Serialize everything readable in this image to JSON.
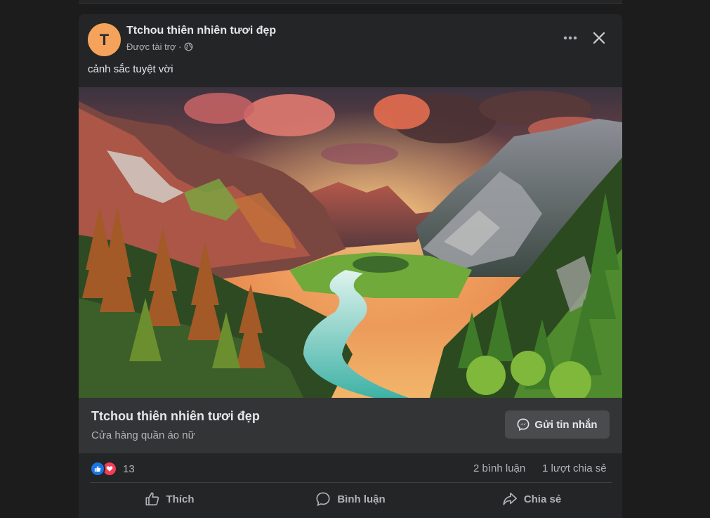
{
  "post": {
    "avatar_letter": "T",
    "page_name": "Ttchou thiên nhiên tươi đẹp",
    "sponsored_label": "Được tài trợ ·",
    "caption": "cảnh sắc tuyệt vời"
  },
  "cta": {
    "title": "Ttchou thiên nhiên tươi đẹp",
    "subtitle": "Cửa hàng quần áo nữ",
    "button_label": "Gửi tin nhắn"
  },
  "stats": {
    "reaction_count": "13",
    "comments": "2 bình luận",
    "shares": "1 lượt chia sẻ"
  },
  "actions": {
    "like": "Thích",
    "comment": "Bình luận",
    "share": "Chia sẻ"
  },
  "colors": {
    "background": "#1c1c1d",
    "card": "#242526",
    "cta_bar": "#333435",
    "avatar": "#f5a35c",
    "like_blue": "#1b74e4",
    "love_red": "#f33e58"
  },
  "icons": [
    "globe-icon",
    "more-icon",
    "close-icon",
    "messenger-icon",
    "like-icon",
    "love-icon",
    "thumbs-up-icon",
    "comment-icon",
    "share-icon"
  ]
}
